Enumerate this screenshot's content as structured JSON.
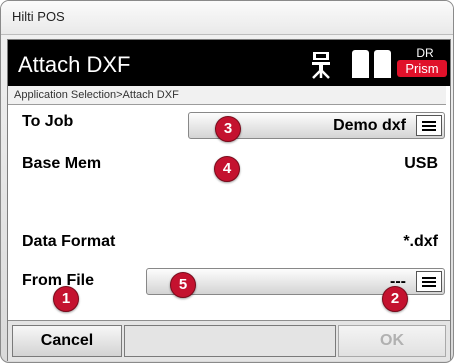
{
  "window": {
    "title": "Hilti POS"
  },
  "header": {
    "app_name": "Attach DXF",
    "tripod_icon": "tripod-icon",
    "instrument_icon": "instrument-bars-icon",
    "mode_label": "DR",
    "prism_label": "Prism",
    "prism_color": "#e0112a"
  },
  "breadcrumb": "Application Selection>Attach DXF",
  "form": {
    "to_job_label": "To Job",
    "to_job_value": "Demo dxf",
    "base_mem_label": "Base Mem",
    "base_mem_value": "USB",
    "data_format_label": "Data Format",
    "data_format_value": "*.dxf",
    "from_file_label": "From File",
    "from_file_value": "---",
    "menu_icon": "hamburger-menu-icon"
  },
  "footer": {
    "cancel_label": "Cancel",
    "middle_label": "",
    "ok_label": "OK"
  },
  "callouts": {
    "one": "1",
    "two": "2",
    "three": "3",
    "four": "4",
    "five": "5",
    "color": "#c4122f"
  }
}
